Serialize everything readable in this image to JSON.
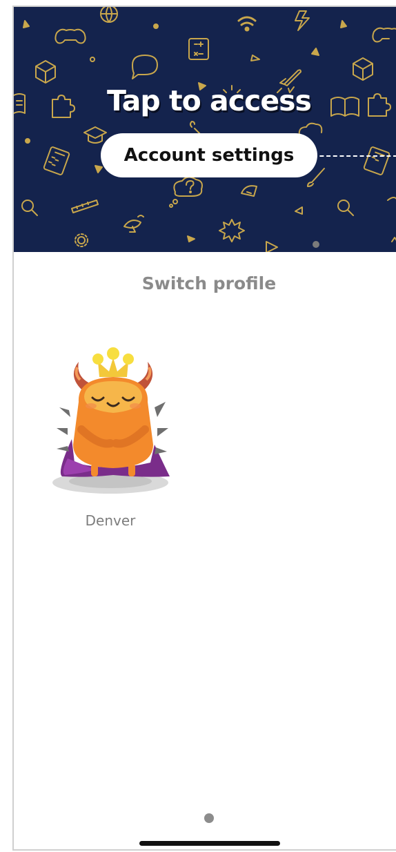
{
  "banner": {
    "title": "Tap to access",
    "button_label": "Account settings",
    "background_color": "#14234d",
    "doodle_color": "#c9a74c"
  },
  "profiles_section": {
    "title": "Switch profile",
    "profiles": [
      {
        "name": "Denver",
        "avatar": "orange-monster-avatar"
      }
    ]
  },
  "pager": {
    "current_page": 1
  },
  "icons": [
    "game-controller-icon",
    "globe-icon",
    "wifi-icon",
    "lightning-icon",
    "calculator-icon",
    "cube-icon",
    "speech-bubble-icon",
    "rocket-icon",
    "book-icon",
    "puzzle-icon",
    "graduation-cap-icon",
    "magnifier-icon",
    "ruler-icon",
    "question-cloud-icon",
    "satellite-dish-icon",
    "protractor-icon",
    "gear-icon",
    "paintbrush-icon",
    "star-burst-icon"
  ]
}
